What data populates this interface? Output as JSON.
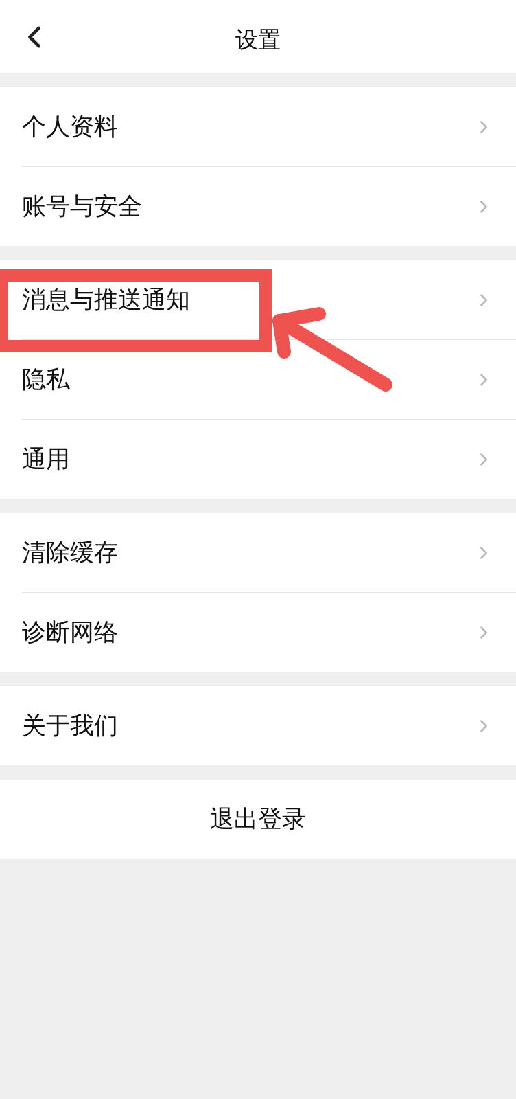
{
  "header": {
    "title": "设置"
  },
  "groups": [
    {
      "items": [
        {
          "label": "个人资料",
          "highlighted": false
        },
        {
          "label": "账号与安全",
          "highlighted": false
        }
      ]
    },
    {
      "items": [
        {
          "label": "消息与推送通知",
          "highlighted": true
        },
        {
          "label": "隐私",
          "highlighted": false
        },
        {
          "label": "通用",
          "highlighted": false
        }
      ]
    },
    {
      "items": [
        {
          "label": "清除缓存",
          "highlighted": false
        },
        {
          "label": "诊断网络",
          "highlighted": false
        }
      ]
    },
    {
      "items": [
        {
          "label": "关于我们",
          "highlighted": false
        }
      ]
    }
  ],
  "logout_button": {
    "label": "退出登录"
  }
}
